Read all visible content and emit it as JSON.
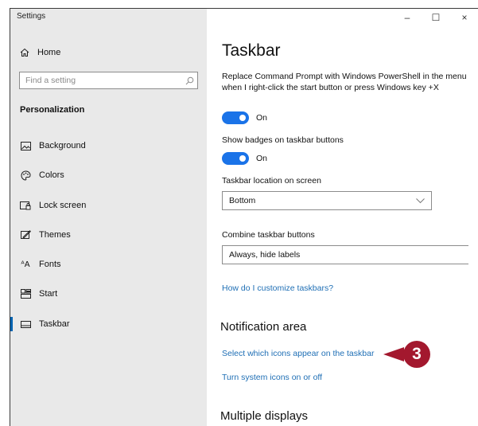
{
  "window": {
    "title": "Settings",
    "controls": {
      "minimize": "–",
      "maximize": "☐",
      "close": "×"
    }
  },
  "sidebar": {
    "home": {
      "label": "Home",
      "icon": "home-icon"
    },
    "search": {
      "placeholder": "Find a setting",
      "icon": "search-icon"
    },
    "section_title": "Personalization",
    "items": [
      {
        "label": "Background",
        "icon": "image-icon"
      },
      {
        "label": "Colors",
        "icon": "palette-icon"
      },
      {
        "label": "Lock screen",
        "icon": "lock-screen-icon"
      },
      {
        "label": "Themes",
        "icon": "themes-icon"
      },
      {
        "label": "Fonts",
        "icon": "fonts-icon"
      },
      {
        "label": "Start",
        "icon": "start-icon"
      },
      {
        "label": "Taskbar",
        "icon": "taskbar-icon",
        "active": true
      }
    ]
  },
  "main": {
    "title": "Taskbar",
    "powershell_desc": "Replace Command Prompt with Windows PowerShell in the menu when I right-click the start button or press Windows key +X",
    "powershell_toggle": {
      "state": "On",
      "on": true
    },
    "badges_label": "Show badges on taskbar buttons",
    "badges_toggle": {
      "state": "On",
      "on": true
    },
    "location_label": "Taskbar location on screen",
    "location_value": "Bottom",
    "combine_label": "Combine taskbar buttons",
    "combine_value": "Always, hide labels",
    "customize_link": "How do I customize taskbars?",
    "notification_heading": "Notification area",
    "select_icons_link": "Select which icons appear on the taskbar",
    "system_icons_link": "Turn system icons on or off",
    "multiple_displays_heading": "Multiple displays"
  },
  "callout": {
    "number": "3",
    "color": "#a3182e"
  },
  "colors": {
    "accent": "#0063b1",
    "toggle": "#1a73e8",
    "link": "#1f6fb5",
    "sidebar_bg": "#e9e9e9"
  }
}
